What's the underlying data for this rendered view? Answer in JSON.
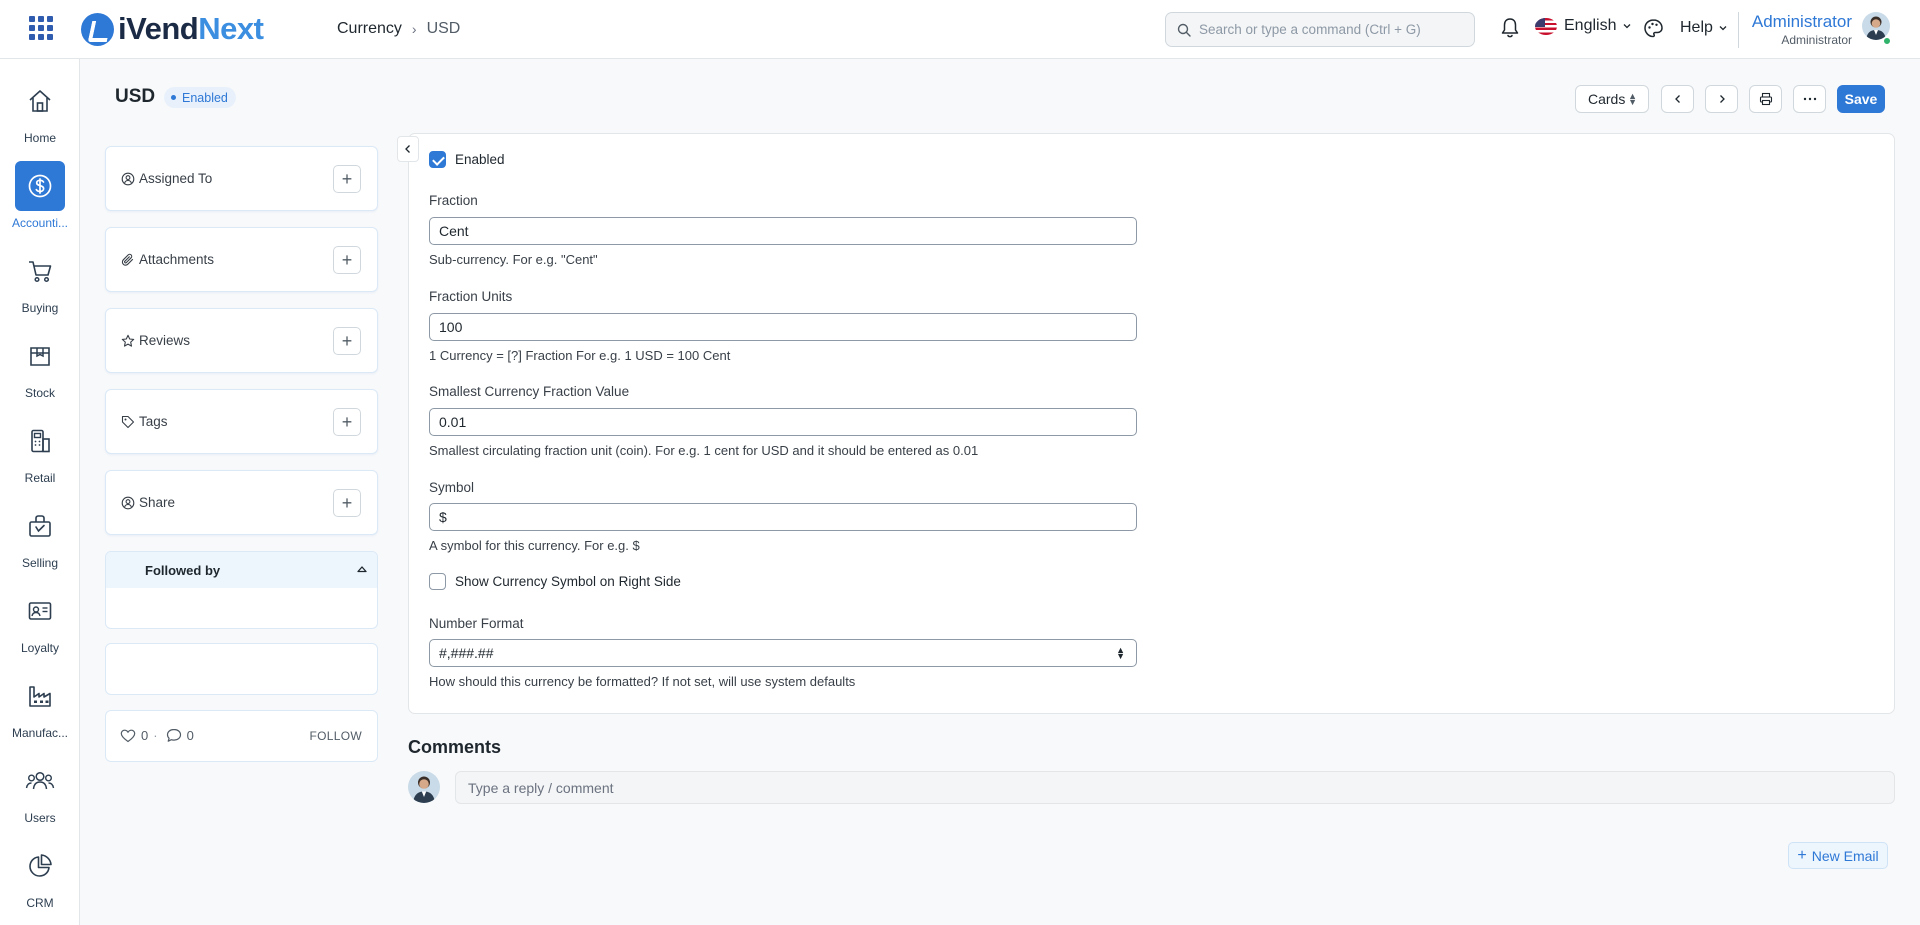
{
  "navbar": {
    "app_name_part1": "iVend",
    "app_name_part2": "Next",
    "breadcrumb": [
      "Currency",
      "USD"
    ],
    "search_placeholder": "Search or type a command (Ctrl + G)",
    "language": "English",
    "help_label": "Help",
    "user_name": "Administrator",
    "user_role": "Administrator"
  },
  "sidebar": {
    "items": [
      {
        "label": "Home",
        "icon": "home-icon"
      },
      {
        "label": "Accounti...",
        "icon": "dollar-icon",
        "active": true
      },
      {
        "label": "Buying",
        "icon": "cart-icon"
      },
      {
        "label": "Stock",
        "icon": "box-icon"
      },
      {
        "label": "Retail",
        "icon": "pos-icon"
      },
      {
        "label": "Selling",
        "icon": "briefcase-icon"
      },
      {
        "label": "Loyalty",
        "icon": "id-card-icon"
      },
      {
        "label": "Manufac...",
        "icon": "factory-icon"
      },
      {
        "label": "Users",
        "icon": "users-icon"
      },
      {
        "label": "CRM",
        "icon": "pie-chart-icon"
      }
    ]
  },
  "page": {
    "title": "USD",
    "status": "Enabled",
    "view_label": "Cards",
    "save_label": "Save"
  },
  "form_sidebar": {
    "assigned_to": "Assigned To",
    "attachments": "Attachments",
    "reviews": "Reviews",
    "tags": "Tags",
    "share": "Share",
    "followed_by": "Followed by",
    "likes": "0",
    "comments": "0",
    "follow_label": "FOLLOW"
  },
  "form": {
    "enabled_label": "Enabled",
    "enabled_checked": true,
    "fraction": {
      "label": "Fraction",
      "value": "Cent",
      "help": "Sub-currency. For e.g. \"Cent\""
    },
    "fraction_units": {
      "label": "Fraction Units",
      "value": "100",
      "help": "1 Currency = [?] Fraction For e.g. 1 USD = 100 Cent"
    },
    "smallest_fraction": {
      "label": "Smallest Currency Fraction Value",
      "value": "0.01",
      "help": "Smallest circulating fraction unit (coin). For e.g. 1 cent for USD and it should be entered as 0.01"
    },
    "symbol": {
      "label": "Symbol",
      "value": "$",
      "help": "A symbol for this currency. For e.g. $"
    },
    "symbol_right_label": "Show Currency Symbol on Right Side",
    "symbol_right_checked": false,
    "number_format": {
      "label": "Number Format",
      "value": "#,###.##",
      "help": "How should this currency be formatted? If not set, will use system defaults"
    }
  },
  "comments": {
    "title": "Comments",
    "placeholder": "Type a reply / comment",
    "new_email_label": "New Email"
  },
  "colors": {
    "accent": "#2e78d6",
    "status_green": "#30b36b"
  }
}
